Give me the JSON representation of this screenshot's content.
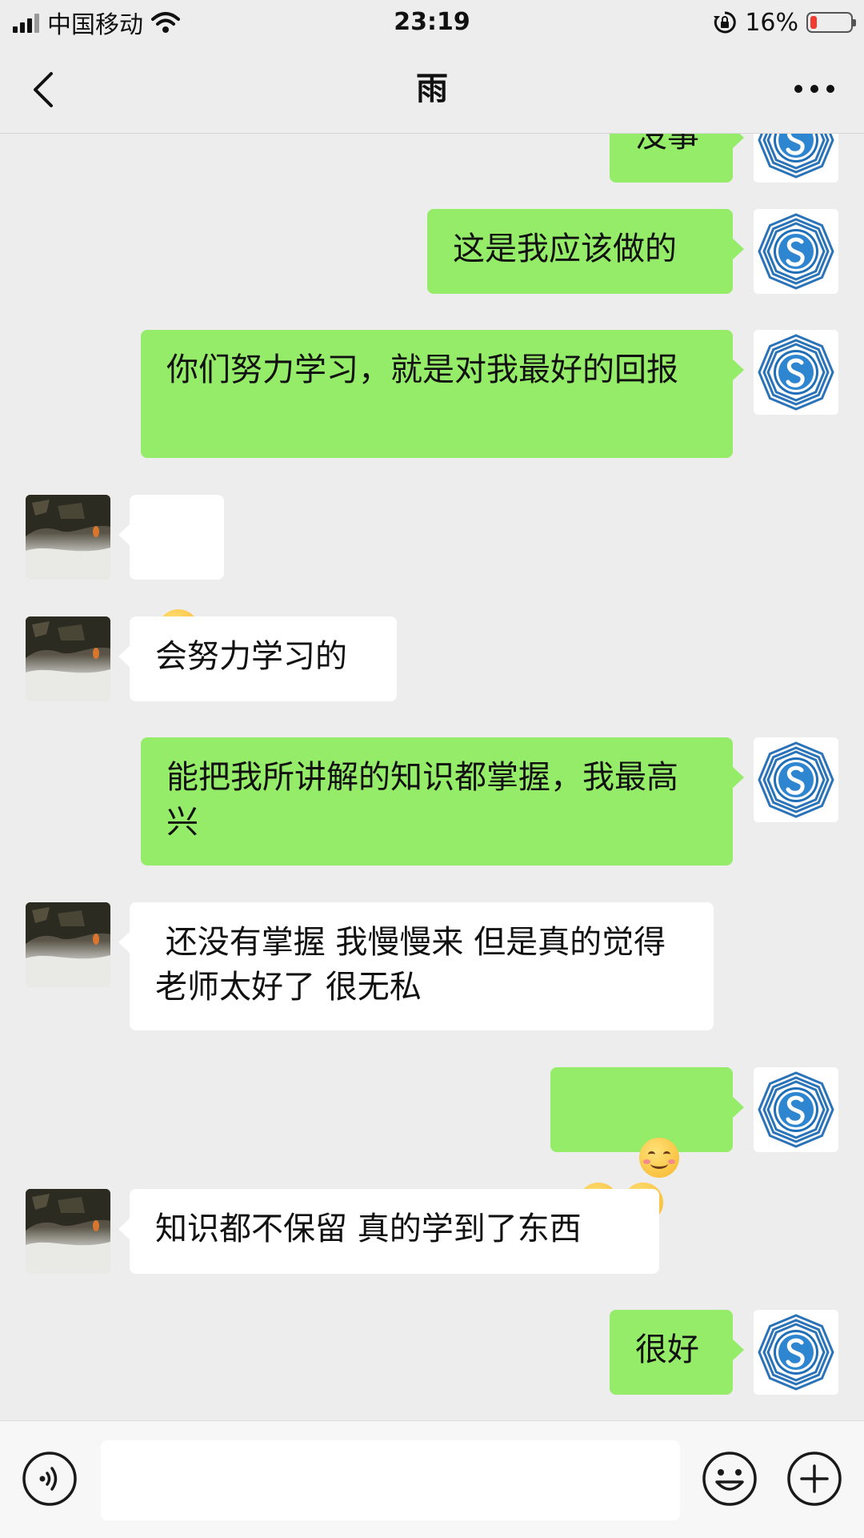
{
  "status_bar": {
    "carrier": "中国移动",
    "time": "23:19",
    "battery": "16%",
    "battery_level": 0.16
  },
  "header": {
    "title": "雨",
    "back_icon": "chevron-left-icon",
    "more_icon": "more-dots-icon"
  },
  "colors": {
    "self_bubble": "#95EC69",
    "other_bubble": "#FFFFFF",
    "background": "#EDEDED"
  },
  "messages": [
    {
      "sender": "self",
      "text": "没事"
    },
    {
      "sender": "self",
      "text": "这是我应该做的"
    },
    {
      "sender": "self",
      "text": "你们努力学习，就是对我最好的回报"
    },
    {
      "sender": "other",
      "emoji": "face-with-tears-of-joy"
    },
    {
      "sender": "other",
      "text": "会努力学习的"
    },
    {
      "sender": "self",
      "text": "能把我所讲解的知识都掌握，我最高兴"
    },
    {
      "sender": "other",
      "text": " 还没有掌握 我慢慢来 但是真的觉得老师太好了 很无私"
    },
    {
      "sender": "self",
      "emoji": "smiling-face-with-smiling-eyes ×3"
    },
    {
      "sender": "other",
      "text": "知识都不保留 真的学到了东西"
    },
    {
      "sender": "self",
      "text": "很好"
    }
  ],
  "input_bar": {
    "voice_icon": "voice-icon",
    "emoji_icon": "emoji-icon",
    "plus_icon": "plus-icon"
  }
}
